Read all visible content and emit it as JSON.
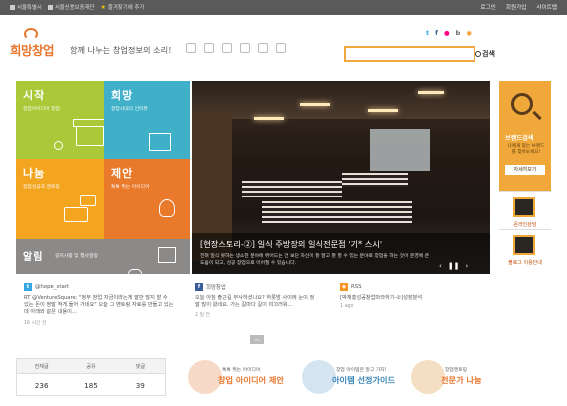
{
  "topbar": {
    "links": [
      "서울특별시",
      "서울신용보증재단",
      "즐겨찾기에 추가"
    ],
    "right_links": [
      "로그인",
      "회원가입",
      "사이트맵"
    ]
  },
  "header": {
    "logo": "희망창업",
    "tagline": "함께 나누는 창업정보의 소리!",
    "search": {
      "placeholder": "",
      "button": "검색"
    },
    "social": [
      "twitter",
      "facebook",
      "flickr",
      "blog",
      "rss"
    ]
  },
  "tiles": [
    {
      "title": "시작",
      "sub": "창업아이디어 창업"
    },
    {
      "title": "희망",
      "sub": "창업시대의 인터뷰"
    },
    {
      "title": "나눔",
      "sub": "창업성공과 멘토링"
    },
    {
      "title": "제안",
      "sub": "톡톡 튀는 아이디어"
    },
    {
      "title": "알림",
      "sub": "공지사항 및 행사일정"
    }
  ],
  "slide": {
    "title": "[현장스토리-②] 일식 주방장의 일식전문점 '기* 스시'",
    "desc": "전혀 일식 못하는 생소한 분야에 뛰어드는 건 보단 자신이 잘 알고 잘 할 수 있는 분야로 창업을 하는 것이 운영에 큰 도움이 되고, 성공 창업으로 이어질 수 있습니다.",
    "controls": [
      "‹",
      "❚❚",
      "›"
    ]
  },
  "side": {
    "brand_title": "브랜드검색",
    "brand_desc": "나에게 맞는 브랜드를 찾아보세요!",
    "brand_btn": "자세히보기",
    "consult_label": "온라인상담",
    "blog_label": "블로그 이용안내"
  },
  "feeds": [
    {
      "name": "@hope_start",
      "text": "RT @VentureSquare: \"정부 창업 자금이라는게 말만 많지 할 수 있는 돈이 정말 적게 들어 가네요\" 오늘 그 멘토링 자료를 만들고 있는데 아래와 같은 내용이...",
      "time": "16 시간 전"
    },
    {
      "name": "희망창업",
      "text": "오늘 아침 출근길 무사하셨나요? 하룻밤 사이에 눈이 정말 많이 왔네요. 가는 길마다 길이 미끄러워...",
      "time": "2 일 전"
    },
    {
      "name": "RSS",
      "text": "[박재홍성공창업마라하기-②]성장분석",
      "time": "1 ago"
    }
  ],
  "stats": {
    "labels": [
      "전체글",
      "공유",
      "댓글"
    ],
    "values": [
      "236",
      "185",
      "39"
    ]
  },
  "ctas": [
    {
      "small": "톡톡 튀는 아이디어",
      "big": "창업 아이디어 제안"
    },
    {
      "small": "창업 아이템은 알고 가자!",
      "big": "아이템 선정가이드"
    },
    {
      "small": "창업멘토링",
      "big": "전문가 나눔"
    }
  ]
}
